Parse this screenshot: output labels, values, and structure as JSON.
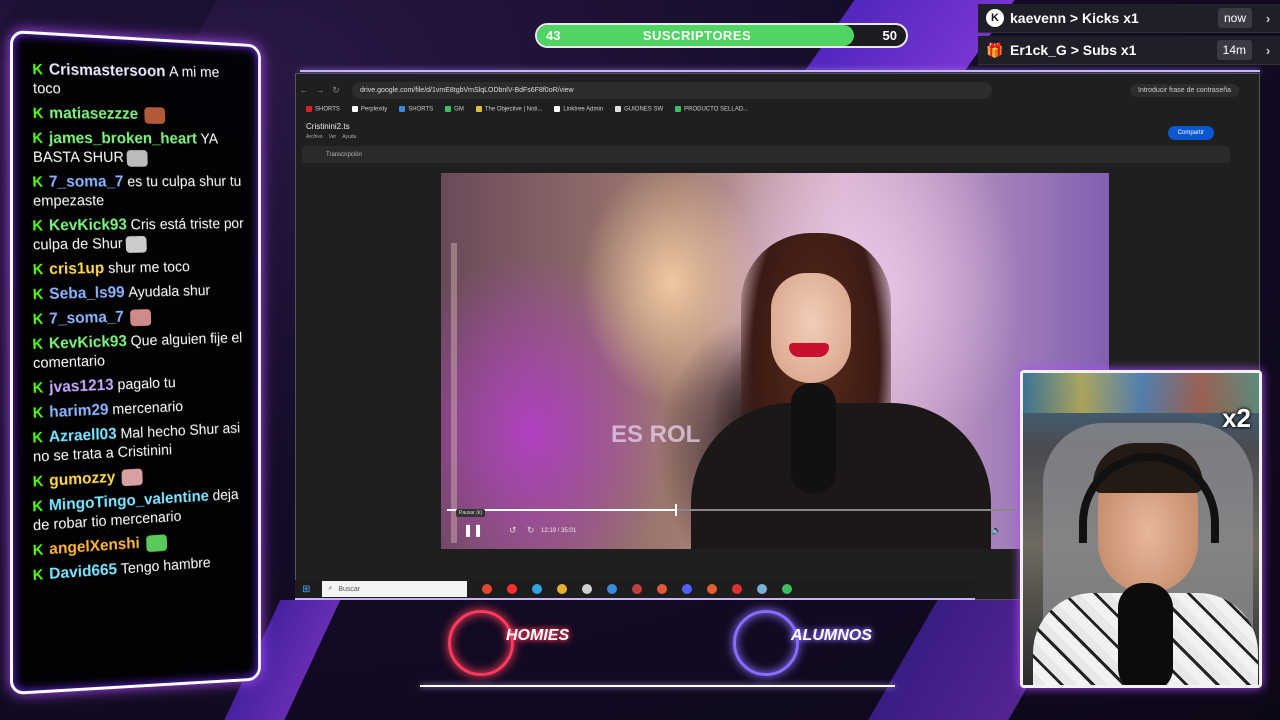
{
  "subs_goal": {
    "current": "43",
    "label": "SUSCRIPTORES",
    "goal": "50",
    "progress_fraction": 0.86,
    "fill_color": "#4fd562"
  },
  "events": [
    {
      "icon": "kick-logo-icon",
      "text": "kaevenn > Kicks x1",
      "time": "now",
      "more": "›"
    },
    {
      "icon": "gift-icon",
      "text": "Er1ck_G > Subs x1",
      "time": "14m",
      "more": "›"
    }
  ],
  "chat": {
    "kick_glyph": "K",
    "messages": [
      {
        "user": "Crismastersoon",
        "color": "#e8e8ff",
        "text": "A mi me toco",
        "emote": ""
      },
      {
        "user": "matiasezzze",
        "color": "#7cf57c",
        "text": "",
        "emote": "#b05a3a"
      },
      {
        "user": "james_broken_heart",
        "color": "#7cf57c",
        "text": "YA BASTA SHUR",
        "emote": "#bbbbbb"
      },
      {
        "user": "7_soma_7",
        "color": "#8ab4ff",
        "text": "es tu culpa shur tu empezaste",
        "emote": ""
      },
      {
        "user": "KevKick93",
        "color": "#7cf57c",
        "text": "Cris está triste por culpa de Shur",
        "emote": "#cccccc"
      },
      {
        "user": "cris1up",
        "color": "#ffd84a",
        "text": "shur me toco",
        "emote": ""
      },
      {
        "user": "Seba_ls99",
        "color": "#8ab4ff",
        "text": "Ayudala shur",
        "emote": ""
      },
      {
        "user": "7_soma_7",
        "color": "#8ab4ff",
        "text": "",
        "emote": "#d08a8a"
      },
      {
        "user": "KevKick93",
        "color": "#7cf57c",
        "text": "Que alguien fije el comentario",
        "emote": ""
      },
      {
        "user": "jvas1213",
        "color": "#c9a8ff",
        "text": "pagalo tu",
        "emote": ""
      },
      {
        "user": "harim29",
        "color": "#8ab4ff",
        "text": "mercenario",
        "emote": ""
      },
      {
        "user": "Azraell03",
        "color": "#7ce4ff",
        "text": "Mal hecho Shur asi no se trata a Cristinini",
        "emote": ""
      },
      {
        "user": "gumozzy",
        "color": "#ffd84a",
        "text": "",
        "emote": "#d8a0a0"
      },
      {
        "user": "MingoTingo_valentine",
        "color": "#7ce4ff",
        "text": "deja de robar tio mercenario",
        "emote": ""
      },
      {
        "user": "angelXenshi",
        "color": "#ffb43a",
        "text": "",
        "emote": "#5ac85a"
      },
      {
        "user": "David665",
        "color": "#7ce4ff",
        "text": "Tengo hambre",
        "emote": ""
      }
    ]
  },
  "browser": {
    "nav": [
      "←",
      "→",
      "↻"
    ],
    "url": "drive.google.com/file/d/1vmE8tgbVmSlqLODbnlV-BdFs6F8f0oR/view",
    "password_prompt": "Introducir frase de contraseña",
    "bookmarks": [
      "SHORTS",
      "Perplexity",
      "SHORTS",
      "GM",
      "The Objective | Noti...",
      "Linktree Admin",
      "GUIONES SW",
      "PRODUCTO SELLAD..."
    ],
    "file_name": "Cristinini2.ts",
    "file_menu": [
      "Archivo",
      "Ver",
      "Ayuda"
    ],
    "share_label": "Compartir",
    "transcript_label": "Transcripción"
  },
  "video": {
    "sign_text": "ES ROL",
    "pause_icon": "❚❚",
    "tooltip": "Pausar (k)",
    "rewind_icon": "↺",
    "forward_icon": "↻",
    "time": "12:19 / 35:01",
    "volume_icon": "🔈",
    "progress_fraction": 0.4
  },
  "taskbar": {
    "start_icon": "⊞",
    "search_placeholder": "Buscar",
    "apps": [
      "#e2482e",
      "#ff3030",
      "#2fa4e0",
      "#e8b030",
      "#d0d0d0",
      "#3a8ae0",
      "#c04040",
      "#e05a3a",
      "#5060ff",
      "#e06030",
      "#e03030",
      "#7ab0d8",
      "#3ac060"
    ]
  },
  "webcam": {
    "badge": "x2"
  },
  "logos": {
    "homies": "HOMIES",
    "alumnos": "ALUMNOS"
  }
}
